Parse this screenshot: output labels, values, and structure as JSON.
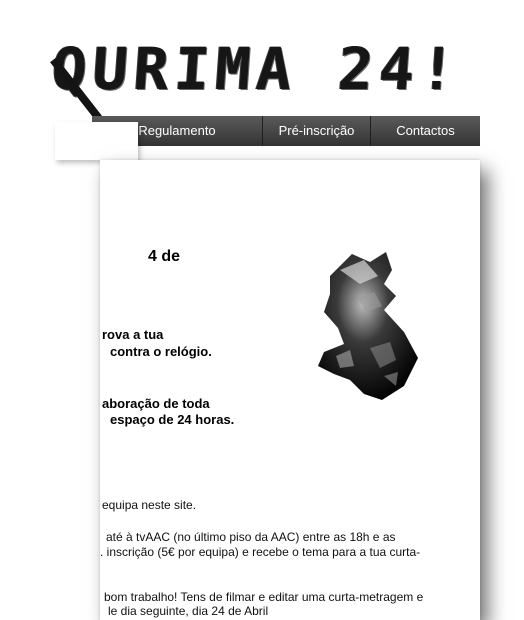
{
  "logo": {
    "text": "QURIMA 24!"
  },
  "nav": {
    "items": [
      {
        "label": "Regulamento"
      },
      {
        "label": "Pré-inscrição"
      },
      {
        "label": "Contactos"
      }
    ]
  },
  "content": {
    "heading": "4 de",
    "intro_lines": [
      "rova a tua",
      "contra o relógio."
    ],
    "challenge_lines": [
      "aboração de toda",
      "espaço de 24 horas."
    ],
    "body_lines": [
      "equipa neste site.",
      "até à tvAAC (no último piso da AAC) entre as 18h e as",
      ". inscrição (5€ por equipa) e recebe o tema para a tua curta-",
      "bom trabalho! Tens de filmar e editar uma curta-metragem e",
      "le dia seguinte, dia 24 de Abril"
    ]
  },
  "image": {
    "icon": "crumpled-foil-sculpture"
  }
}
